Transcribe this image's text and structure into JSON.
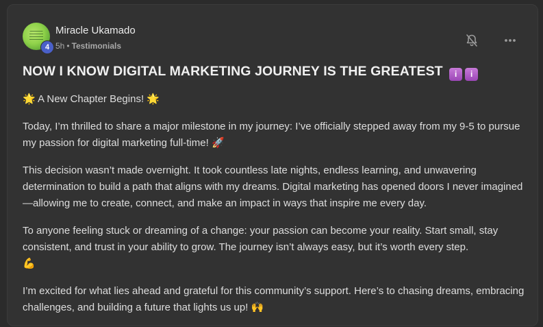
{
  "post": {
    "author": {
      "name": "Miracle Ukamado",
      "level": "4"
    },
    "meta": {
      "time": "5h",
      "separator": "•",
      "category": "Testimonials"
    },
    "title": "NOW I KNOW DIGITAL MARKETING JOURNEY IS THE GREATEST",
    "title_emoji_label": "i",
    "subtitle": {
      "emoji_left": "🌟",
      "text": "A New Chapter Begins!",
      "emoji_right": "🌟"
    },
    "paragraphs": [
      {
        "text": "Today, I’m thrilled to share a major milestone in my journey: I’ve officially stepped away from my 9-5 to pursue my passion for digital marketing full-time!",
        "emoji": "🚀"
      },
      {
        "text": "This decision wasn’t made overnight. It took countless late nights, endless learning, and unwavering determination to build a path that aligns with my dreams. Digital marketing has opened doors I never imagined—allowing me to create, connect, and make an impact in ways that inspire me every day.",
        "emoji": ""
      },
      {
        "text": "To anyone feeling stuck or dreaming of a change: your passion can become your reality. Start small, stay consistent, and trust in your ability to grow. The journey isn’t always easy, but it’s worth every step.",
        "emoji": "💪"
      },
      {
        "text": "I’m excited for what lies ahead and grateful for this community’s support. Here’s to chasing dreams, embracing challenges, and building a future that lights us up!",
        "emoji": "🙌"
      }
    ]
  },
  "icons": {
    "bell": "bell-off-icon",
    "more": "more-horizontal-icon"
  },
  "colors": {
    "background": "#2b2b2b",
    "card": "#323232",
    "text": "#dedede",
    "muted": "#a9a9a9",
    "badge": "#4a60c8"
  }
}
